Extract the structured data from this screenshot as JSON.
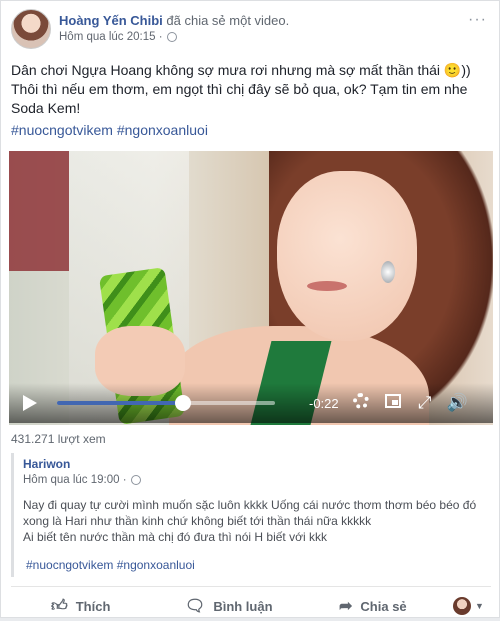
{
  "post": {
    "author": "Hoàng Yến Chibi",
    "action": "đã chia sẻ một video.",
    "timestamp": "Hôm qua lúc 20:15 ·",
    "text": "Dân chơi Ngựa Hoang không sợ mưa rơi nhưng mà sợ mất thần thái 🙂)) Thôi thì nếu em thơm, em ngọt thì chị đây sẽ bỏ qua, ok? Tạm tin em nhe Soda Kem!",
    "hashtags": "#nuocngotvikem #ngonxoanluoi"
  },
  "video": {
    "time_remaining": "-0:22",
    "progress": 0.58,
    "views": "431.271 lượt xem"
  },
  "shared": {
    "author": "Hariwon",
    "timestamp": "Hôm qua lúc 19:00 ·",
    "text_line1": "Nay đi quay tự cười mình muốn sặc luôn kkkk Uống cái nước thơm thơm béo béo đó xong là Hari như thần kinh chứ không biết tới thần thái nữa kkkkk",
    "text_line2": "Ai biết tên nước thần mà chị đó đưa thì nói H biết với kkk",
    "hashtags": "#nuocngotvikem #ngonxoanluoi"
  },
  "actions": {
    "like": "Thích",
    "comment": "Bình luận",
    "share": "Chia sẻ"
  },
  "colors": {
    "link": "#385898",
    "progress": "#4267b2"
  }
}
